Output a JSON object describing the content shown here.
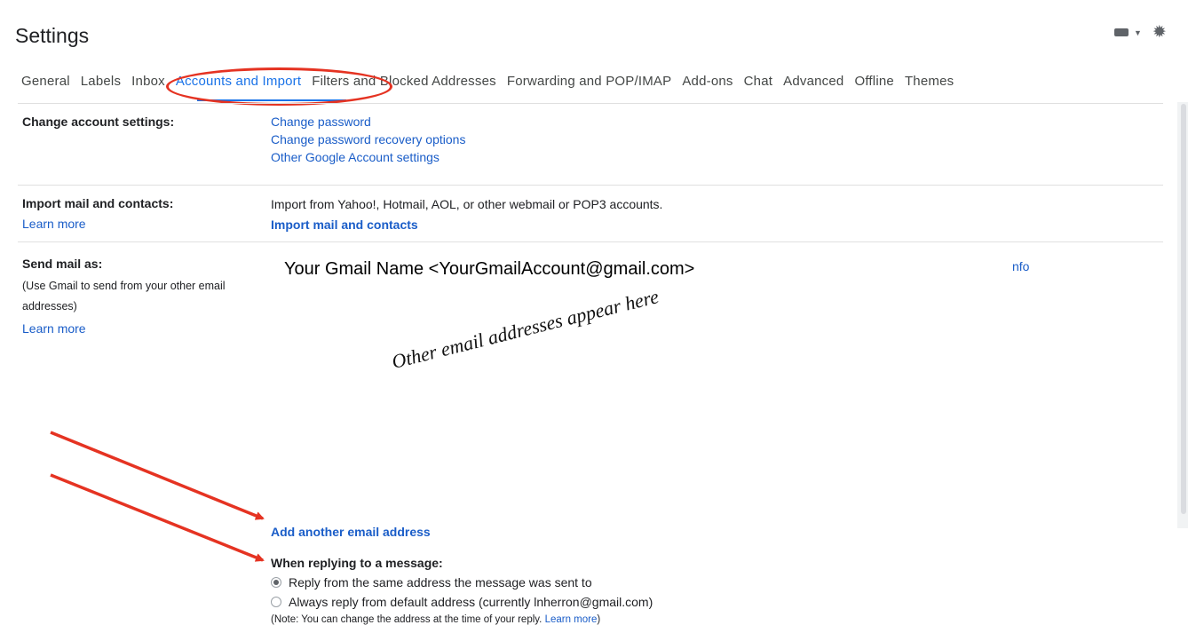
{
  "header": {
    "title": "Settings",
    "keyboard_icon": "keyboard-icon",
    "settings_icon": "gear-icon"
  },
  "tabs": [
    {
      "label": "General"
    },
    {
      "label": "Labels"
    },
    {
      "label": "Inbox"
    },
    {
      "label": "Accounts and Import",
      "active": true
    },
    {
      "label": "Filters and Blocked Addresses"
    },
    {
      "label": "Forwarding and POP/IMAP"
    },
    {
      "label": "Add-ons"
    },
    {
      "label": "Chat"
    },
    {
      "label": "Advanced"
    },
    {
      "label": "Offline"
    },
    {
      "label": "Themes"
    }
  ],
  "change_account": {
    "label": "Change account settings:",
    "links": [
      "Change password",
      "Change password recovery options",
      "Other Google Account settings"
    ]
  },
  "import_mail": {
    "label": "Import mail and contacts:",
    "learn_more": "Learn more",
    "description": "Import from Yahoo!, Hotmail, AOL, or other webmail or POP3 accounts.",
    "action": "Import mail and contacts"
  },
  "send_mail": {
    "label": "Send mail as:",
    "desc_line1": "(Use Gmail to send from your other email",
    "desc_line2": "addresses)",
    "learn_more": "Learn more",
    "account": "Your Gmail Name <YourGmailAccount@gmail.com>",
    "info_link": "nfo",
    "annotation": "Other email addresses appear here",
    "add_address": "Add another email address"
  },
  "replying": {
    "heading": "When replying to a message:",
    "option1": "Reply from the same address the message was sent to",
    "option2": "Always reply from default address (currently lnherron@gmail.com)",
    "note": "(Note: You can change the address at the time of your reply.",
    "note_link": "Learn more",
    "note_end": ")"
  },
  "annotation_color": "#e53322"
}
